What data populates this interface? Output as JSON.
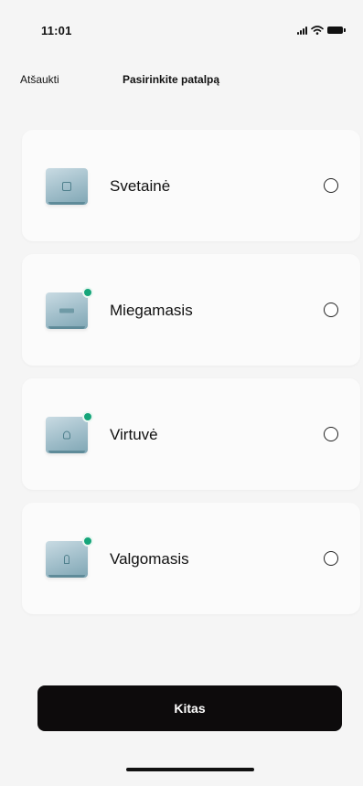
{
  "status_bar": {
    "time": "11:01",
    "icons": [
      "signal-icon",
      "wifi-icon",
      "battery-icon"
    ]
  },
  "header": {
    "cancel_label": "Atšaukti",
    "title": "Pasirinkite patalpą"
  },
  "rooms": [
    {
      "name": "Svetainė",
      "icon": "living-room-icon",
      "selected": false,
      "badge": false
    },
    {
      "name": "Miegamasis",
      "icon": "bedroom-icon",
      "selected": false,
      "badge": true
    },
    {
      "name": "Virtuvė",
      "icon": "kitchen-icon",
      "selected": false,
      "badge": true
    },
    {
      "name": "Valgomasis",
      "icon": "dining-room-icon",
      "selected": false,
      "badge": true
    }
  ],
  "actions": {
    "next_label": "Kitas"
  },
  "colors": {
    "background": "#f5f5f5",
    "card": "#fbfbfb",
    "primary_button": "#0d0b0c",
    "badge": "#15a57a",
    "thumb": "#9fbdc9"
  }
}
